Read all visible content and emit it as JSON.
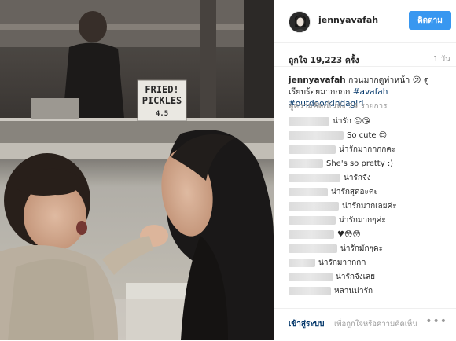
{
  "post": {
    "username": "jennyavafah",
    "follow_label": "ติดตาม",
    "likes": "ถูกใจ 19,223 ครั้ง",
    "time": "1 วัน",
    "caption_user": "jennyavafah",
    "caption_text": " กวนมากดูท่าหน้า 😕 ดูเรียบร้อยมากกกก ",
    "caption_tags": "#avafah #outdoorkindagirl",
    "view_more": "ดูความคิดเห็นทั้ง 24 รายการ"
  },
  "media": {
    "sign_lines": [
      "FRIED!",
      "PICKLES",
      "4.5"
    ]
  },
  "comments": [
    {
      "text": "น่ารัก 😐😘"
    },
    {
      "text": "So cute 😍"
    },
    {
      "text": "น่ารักมากกกกคะ"
    },
    {
      "text": "She's so pretty :)"
    },
    {
      "text": "น่ารักจัง"
    },
    {
      "text": "น่ารักสุดอะคะ"
    },
    {
      "text": "น่ารักมากเลยค่ะ"
    },
    {
      "text": "น่ารักมากๆค่ะ"
    },
    {
      "text": "♥😳😳"
    },
    {
      "text": "น่ารักมักๆคะ"
    },
    {
      "text": "น่ารักมากกกก"
    },
    {
      "text": "น่ารักจังเลย"
    },
    {
      "text": "หลานน่ารัก"
    }
  ],
  "footer": {
    "login": "เข้าสู่ระบบ",
    "hint": "เพื่อถูกใจหรือความคิดเห็น",
    "more": "•••"
  }
}
